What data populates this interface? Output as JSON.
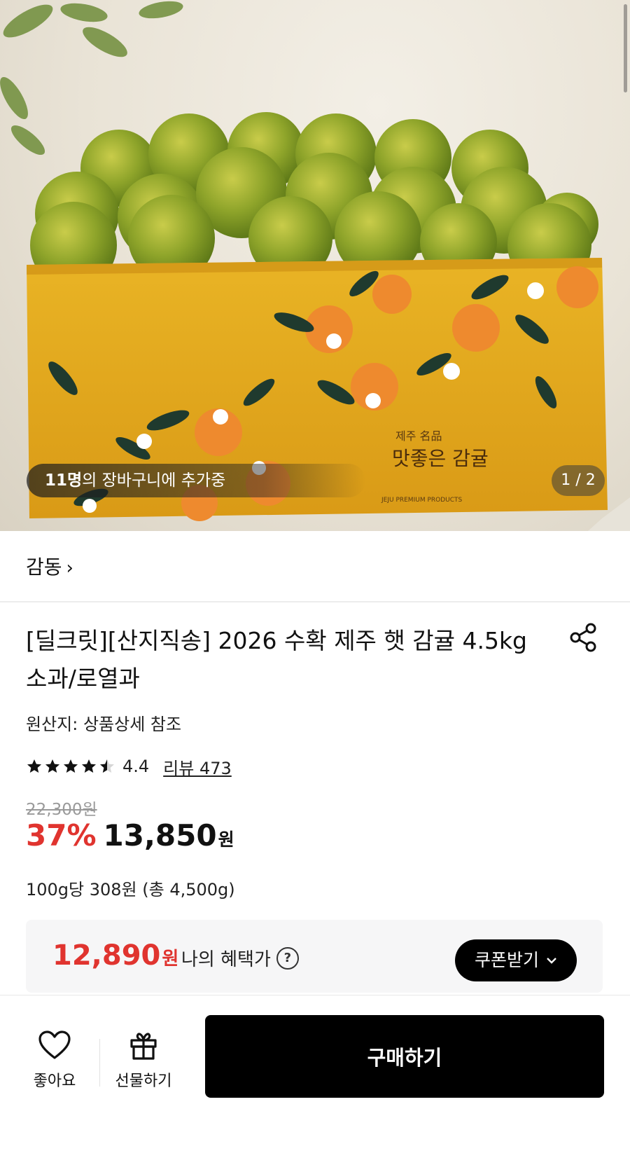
{
  "hero": {
    "cart_count": "11명",
    "cart_text": "의 장바구니에 추가중",
    "page_indicator": "1 / 2",
    "box_small_text": "제주 名品",
    "box_big_text": "맛좋은 감귤",
    "box_footer_text": "JEJU PREMIUM PRODUCTS"
  },
  "brand": {
    "name": "감동",
    "chevron": "›"
  },
  "product": {
    "title": "[딜크릿][산지직송] 2026 수확 제주 햇 감귤 4.5kg 소과/로열과",
    "origin": "원산지: 상품상세 참조",
    "rating": "4.4",
    "stars_filled": 4.5,
    "review_label": "리뷰 473",
    "original_price": "22,300원",
    "discount": "37%",
    "price": "13,850",
    "currency": "원",
    "unit_price": "100g당 308원 (총 4,500g)"
  },
  "benefit": {
    "price": "12,890",
    "currency": "원",
    "label": "나의 혜택가",
    "help_icon": "?",
    "coupon_button": "쿠폰받기"
  },
  "bottom": {
    "like_label": "좋아요",
    "gift_label": "선물하기",
    "buy_label": "구매하기"
  },
  "icons": [
    "share-icon",
    "star-icon",
    "question-circle-icon",
    "chevron-down-icon",
    "heart-icon",
    "gift-icon",
    "chevron-right-icon"
  ],
  "colors": {
    "accent_red": "#e0342f",
    "black": "#000000",
    "box_yellow": "#e8ae1e"
  }
}
